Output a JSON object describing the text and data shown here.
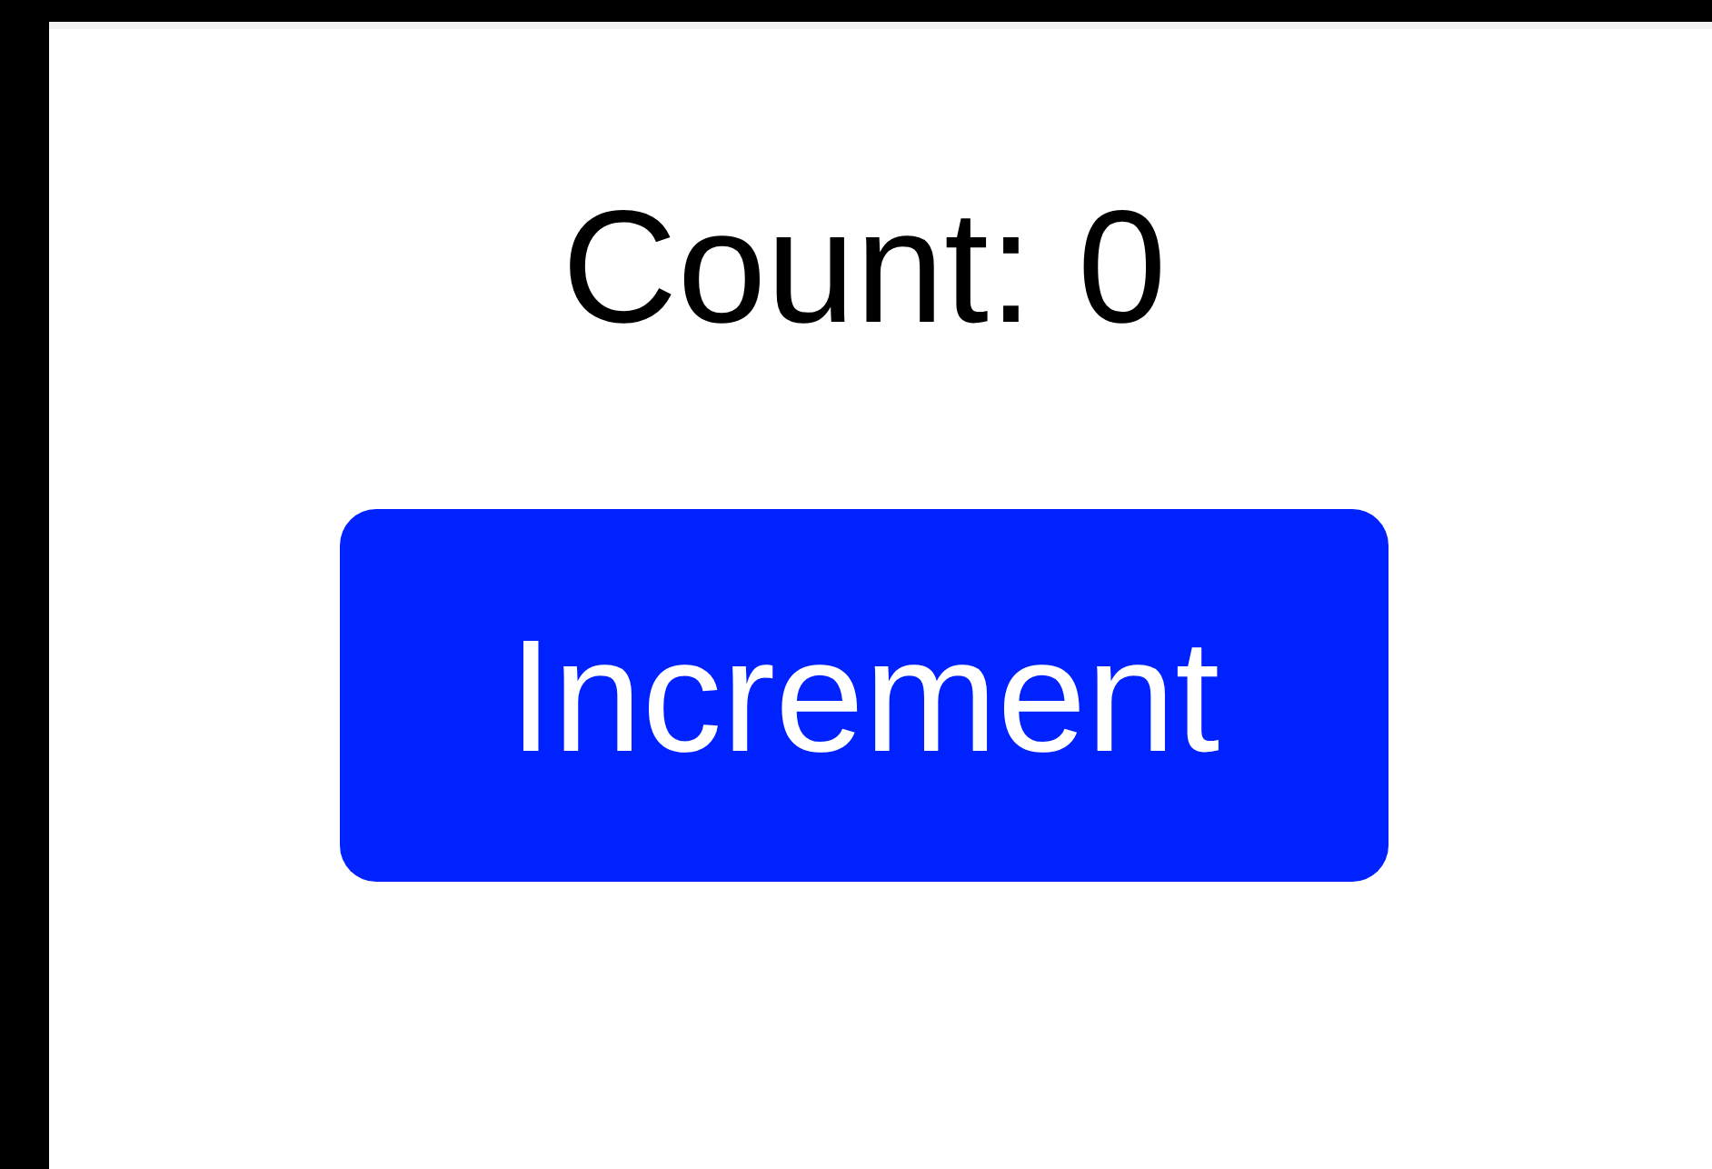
{
  "counter": {
    "label": "Count: 0"
  },
  "button": {
    "label": "Increment"
  }
}
